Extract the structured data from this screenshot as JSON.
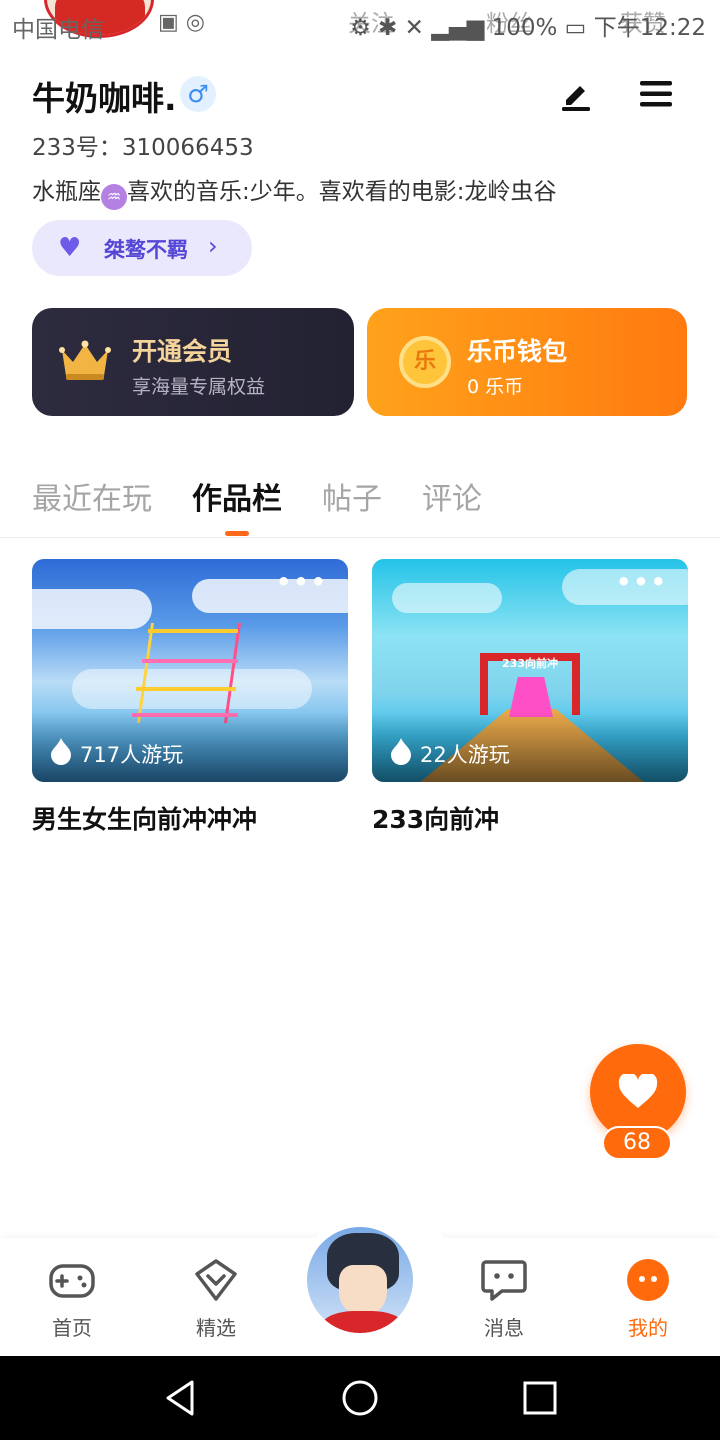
{
  "status_bar": {
    "carrier": "中国电信",
    "ghost_left": "关注",
    "ghost_mid": "粉丝",
    "ghost_right": "获赞",
    "battery": "100%",
    "time": "下午12:22"
  },
  "profile": {
    "nickname": "牛奶咖啡.",
    "gender_symbol": "♂",
    "uid": "233号：310066453",
    "zodiac_symbol": "♒",
    "bio_prefix": "水瓶座",
    "bio_rest": "喜欢的音乐:少年。喜欢看的电影:龙岭虫谷",
    "tag_label": "桀骜不羁"
  },
  "cards": {
    "vip_title": "开通会员",
    "vip_subtitle": "享海量专属权益",
    "wallet_title": "乐币钱包",
    "wallet_subtitle": "0 乐币",
    "coin_glyph": "乐"
  },
  "tabs": [
    {
      "label": "最近在玩"
    },
    {
      "label": "作品栏"
    },
    {
      "label": "帖子"
    },
    {
      "label": "评论"
    }
  ],
  "active_tab": "作品栏",
  "works": [
    {
      "plays": "717人游玩",
      "title": "男生女生向前冲冲冲"
    },
    {
      "plays": "22人游玩",
      "title": "233向前冲",
      "gate_label": "233向前冲"
    }
  ],
  "like": {
    "count": "68"
  },
  "bottom_nav": [
    {
      "label": "首页",
      "icon": "gamepad-icon"
    },
    {
      "label": "精选",
      "icon": "heart-box-icon"
    },
    {
      "label": "消息",
      "icon": "chat-icon"
    },
    {
      "label": "我的",
      "icon": "profile-dots-icon"
    }
  ],
  "colors": {
    "accent": "#ff6a0c",
    "tag_bg": "#eae8fd",
    "tag_text": "#5546d6",
    "vip_bg": "#2d2b3e",
    "vip_text": "#f5d49b",
    "wallet_bg": "#ff8a14"
  }
}
